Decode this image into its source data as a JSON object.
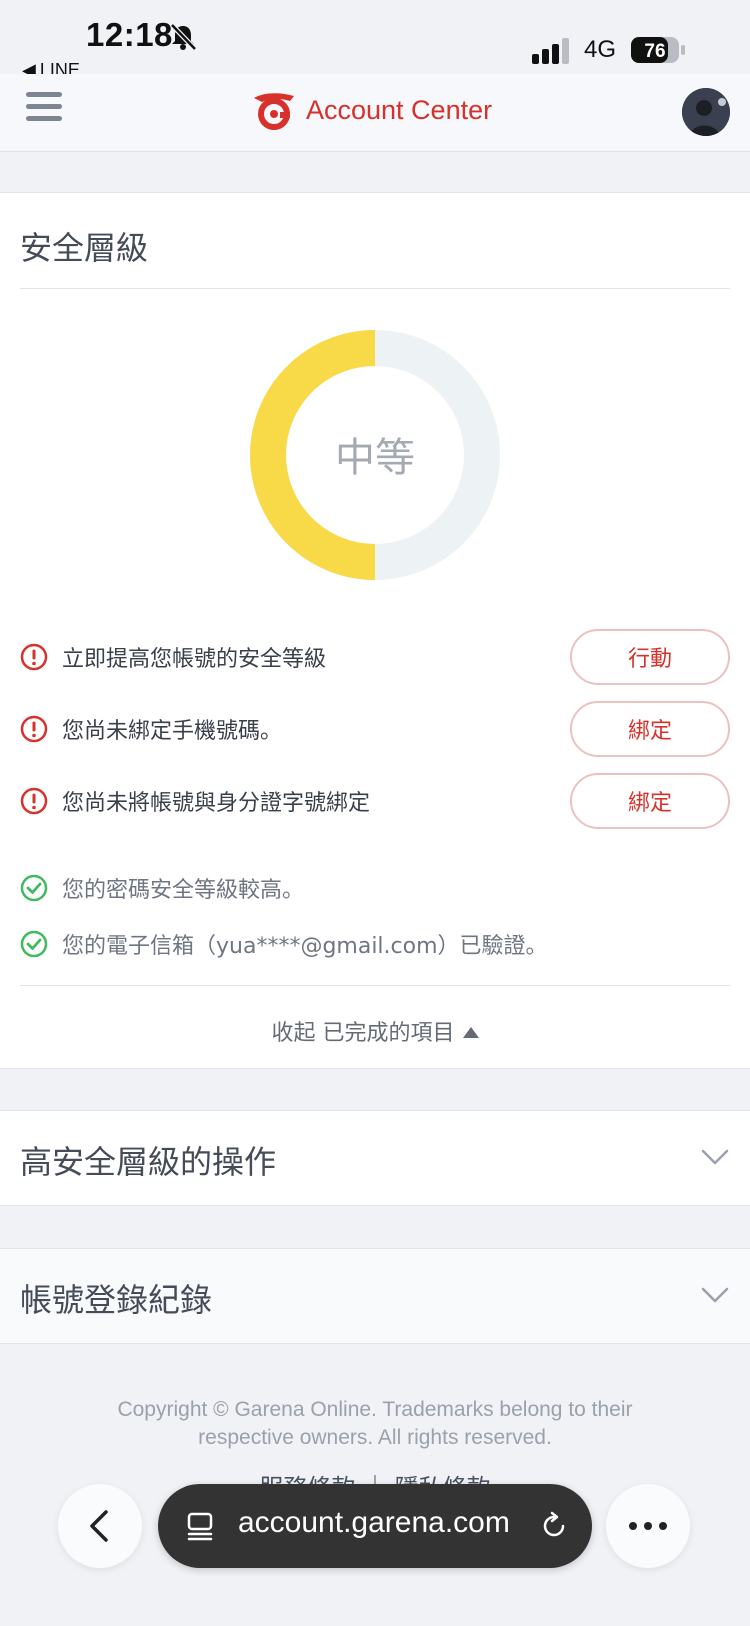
{
  "status_bar": {
    "time": "12:18",
    "back_app": "LINE",
    "network": "4G",
    "battery": "76"
  },
  "header": {
    "title": "Account Center"
  },
  "security": {
    "title": "安全層級",
    "level": "中等",
    "level_fraction": 0.5,
    "colors": {
      "filled": "#f8d948",
      "empty": "#edf2f5",
      "alert": "#d8302a",
      "ok": "#3fbb5e"
    },
    "alerts": [
      {
        "text": "立即提高您帳號的安全等級",
        "button": "行動"
      },
      {
        "text": "您尚未綁定手機號碼。",
        "button": "綁定"
      },
      {
        "text": "您尚未將帳號與身分證字號綁定",
        "button": "綁定"
      }
    ],
    "completed": [
      {
        "text": "您的密碼安全等級較高。"
      },
      {
        "text": "您的電子信箱（yua****@gmail.com）已驗證。"
      }
    ],
    "collapse_label": "收起 已完成的項目"
  },
  "sections": {
    "high_security": "高安全層級的操作",
    "login_history": "帳號登錄紀錄"
  },
  "footer": {
    "copyright_line1": "Copyright © Garena Online. Trademarks belong to their",
    "copyright_line2": "respective owners. All rights reserved.",
    "links": "服務條款 ｜ 隱私條款"
  },
  "browser": {
    "url": "account.garena.com"
  }
}
